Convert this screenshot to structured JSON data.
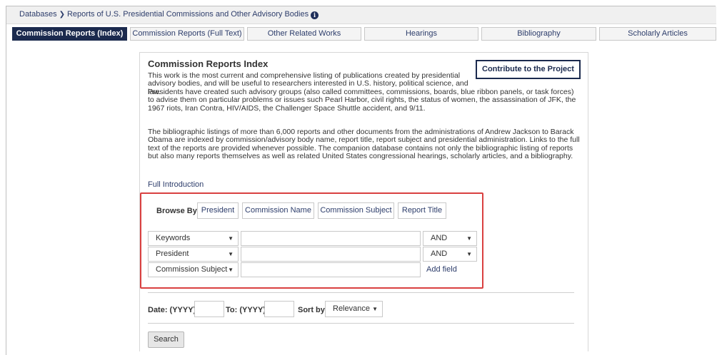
{
  "breadcrumb": {
    "root": "Databases",
    "current": "Reports of U.S. Presidential Commissions and Other Advisory Bodies",
    "info_icon": "info-circle-icon"
  },
  "tabs": [
    {
      "label": "Commission Reports (Index)",
      "active": true
    },
    {
      "label": "Commission Reports (Full Text)",
      "active": false
    },
    {
      "label": "Other Related Works",
      "active": false
    },
    {
      "label": "Hearings",
      "active": false
    },
    {
      "label": "Bibliography",
      "active": false
    },
    {
      "label": "Scholarly Articles",
      "active": false
    }
  ],
  "main": {
    "title": "Commission Reports Index",
    "contribute_label": "Contribute to the Project",
    "intro_p1_top": "This work is the most current and comprehensive listing of publications created by presidential advisory bodies, and will be useful to researchers interested in U.S. history, political science, and law.",
    "intro_p1_rest": "Presidents have created such advisory groups (also called committees, commissions, boards, blue ribbon panels, or task forces) to advise them on particular problems or issues such Pearl Harbor, civil rights, the status of women, the assassination of JFK, the 1967 riots, Iran Contra, HIV/AIDS, the Challenger Space Shuttle accident, and 9/11.",
    "intro_p2": "The bibliographic listings of more than 6,000 reports and other documents from the administrations of Andrew Jackson to Barack Obama are indexed by commission/advisory body name, report title, report subject and presidential administration. Links to the full text of the reports are provided whenever possible. The companion database contains not only the bibliographic listing of reports but also many reports themselves as well as related United States congressional hearings, scholarly articles, and a bibliography.",
    "full_intro_link": "Full Introduction"
  },
  "browse": {
    "label": "Browse By:",
    "buttons": [
      "President",
      "Commission Name",
      "Commission Subject",
      "Report Title"
    ]
  },
  "search_rows": [
    {
      "field": "Keywords",
      "value": "",
      "operator": "AND"
    },
    {
      "field": "President",
      "value": "",
      "operator": "AND"
    },
    {
      "field": "Commission Subject",
      "value": "",
      "operator": ""
    }
  ],
  "add_field_label": "Add field",
  "filters": {
    "date_from_label": "Date: (YYYY)",
    "date_to_label": "To: (YYYY)",
    "date_from_value": "",
    "date_to_value": "",
    "sort_label": "Sort by:",
    "sort_value": "Relevance"
  },
  "search_button": "Search",
  "colors": {
    "accent": "#1b2a4e",
    "link": "#2d3d6b",
    "highlight_border": "#d94040"
  }
}
